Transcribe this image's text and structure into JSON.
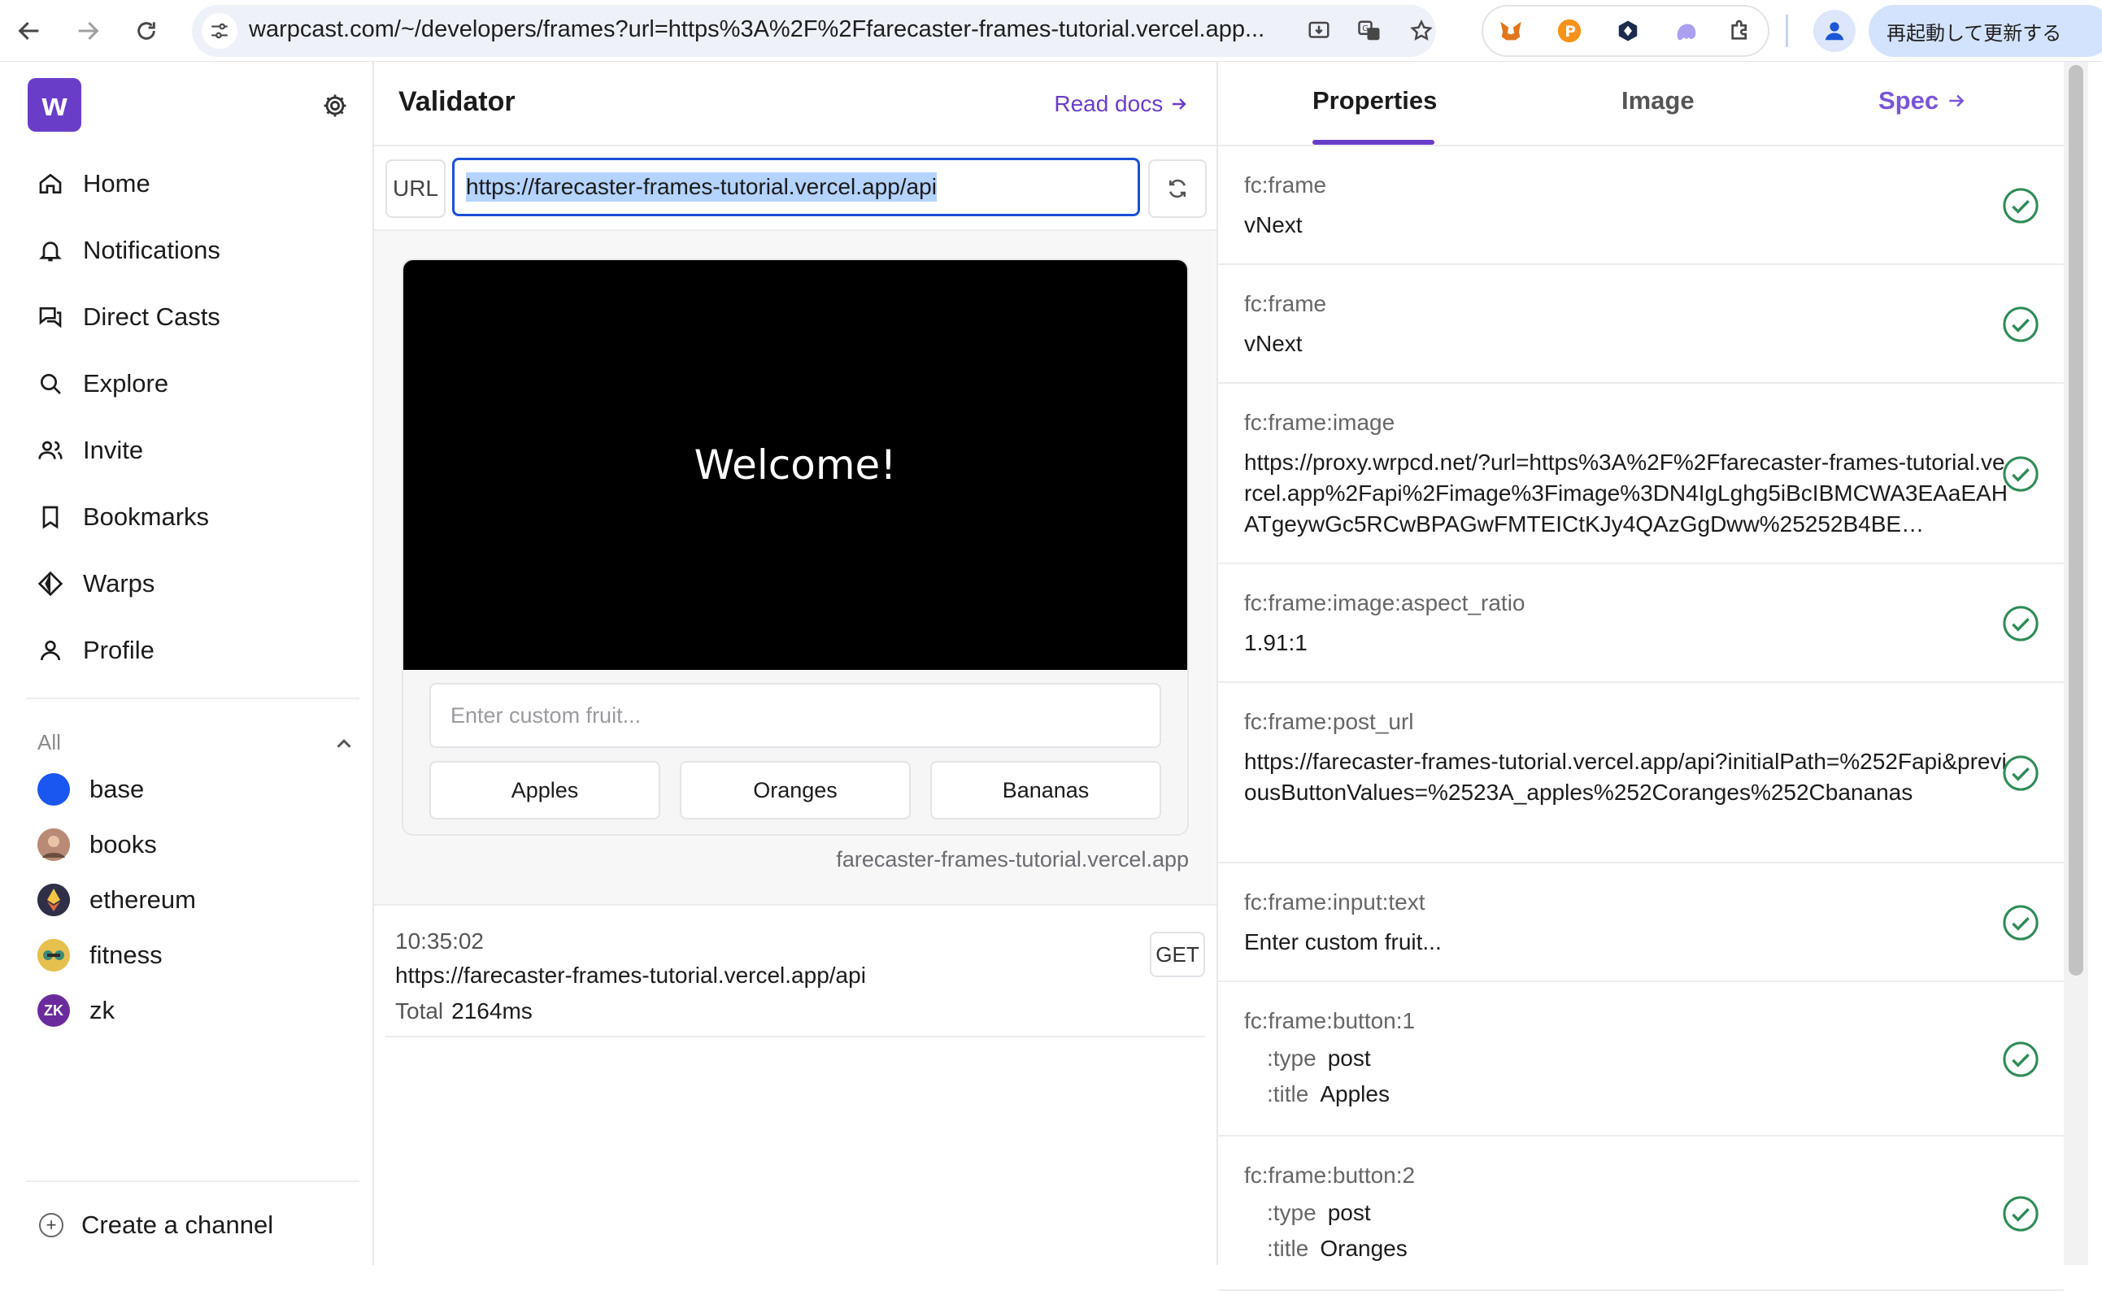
{
  "browser": {
    "url": "warpcast.com/~/developers/frames?url=https%3A%2F%2Ffarecaster-frames-tutorial.vercel.app...",
    "update_button": "再起動して更新する"
  },
  "sidebar": {
    "logo_letter": "w",
    "nav": [
      {
        "label": "Home",
        "icon": "home-icon"
      },
      {
        "label": "Notifications",
        "icon": "bell-icon"
      },
      {
        "label": "Direct Casts",
        "icon": "chat-icon"
      },
      {
        "label": "Explore",
        "icon": "search-icon"
      },
      {
        "label": "Invite",
        "icon": "users-icon"
      },
      {
        "label": "Bookmarks",
        "icon": "bookmark-icon"
      },
      {
        "label": "Warps",
        "icon": "diamond-icon"
      },
      {
        "label": "Profile",
        "icon": "user-icon"
      }
    ],
    "channels_heading": "All",
    "channels": [
      {
        "name": "base",
        "color": "#1a56f0"
      },
      {
        "name": "books",
        "color": "#c98a6a"
      },
      {
        "name": "ethereum",
        "color": "#3b3b56"
      },
      {
        "name": "fitness",
        "color": "#e0b64a"
      },
      {
        "name": "zk",
        "color": "#6a2c9c"
      }
    ],
    "create_channel": "Create a channel"
  },
  "validator": {
    "title": "Validator",
    "read_docs": "Read docs",
    "url_label": "URL",
    "url_value": "https://farecaster-frames-tutorial.vercel.app/api",
    "frame": {
      "image_text": "Welcome!",
      "input_placeholder": "Enter custom fruit...",
      "buttons": [
        "Apples",
        "Oranges",
        "Bananas"
      ],
      "domain": "farecaster-frames-tutorial.vercel.app"
    },
    "request": {
      "time": "10:35:02",
      "url": "https://farecaster-frames-tutorial.vercel.app/api",
      "total_label": "Total",
      "total_value": "2164ms",
      "method": "GET"
    }
  },
  "properties": {
    "tabs": [
      "Properties",
      "Image",
      "Spec"
    ],
    "active_tab": "Properties",
    "items": [
      {
        "key": "fc:frame",
        "value": "vNext"
      },
      {
        "key": "fc:frame",
        "value": "vNext"
      },
      {
        "key": "fc:frame:image",
        "value": "https://proxy.wrpcd.net/?url=https%3A%2F%2Ffarecaster-frames-tutorial.vercel.app%2Fapi%2Fimage%3Fimage%3DN4IgLghg5iBcIBMCWA3EAaEAHATgeywGc5RCwBPAGwFMTEICtKJy4QAzGgDww%25252B4BE…"
      },
      {
        "key": "fc:frame:image:aspect_ratio",
        "value": "1.91:1"
      },
      {
        "key": "fc:frame:post_url",
        "value": "https://farecaster-frames-tutorial.vercel.app/api?initialPath=%252Fapi&previousButtonValues=%2523A_apples%252Coranges%252Cbananas"
      },
      {
        "key": "fc:frame:input:text",
        "value": "Enter custom fruit..."
      },
      {
        "key": "fc:frame:button:1",
        "type_label": ":type",
        "type": "post",
        "title_label": ":title",
        "title": "Apples"
      },
      {
        "key": "fc:frame:button:2",
        "type_label": ":type",
        "type": "post",
        "title_label": ":title",
        "title": "Oranges"
      }
    ]
  }
}
